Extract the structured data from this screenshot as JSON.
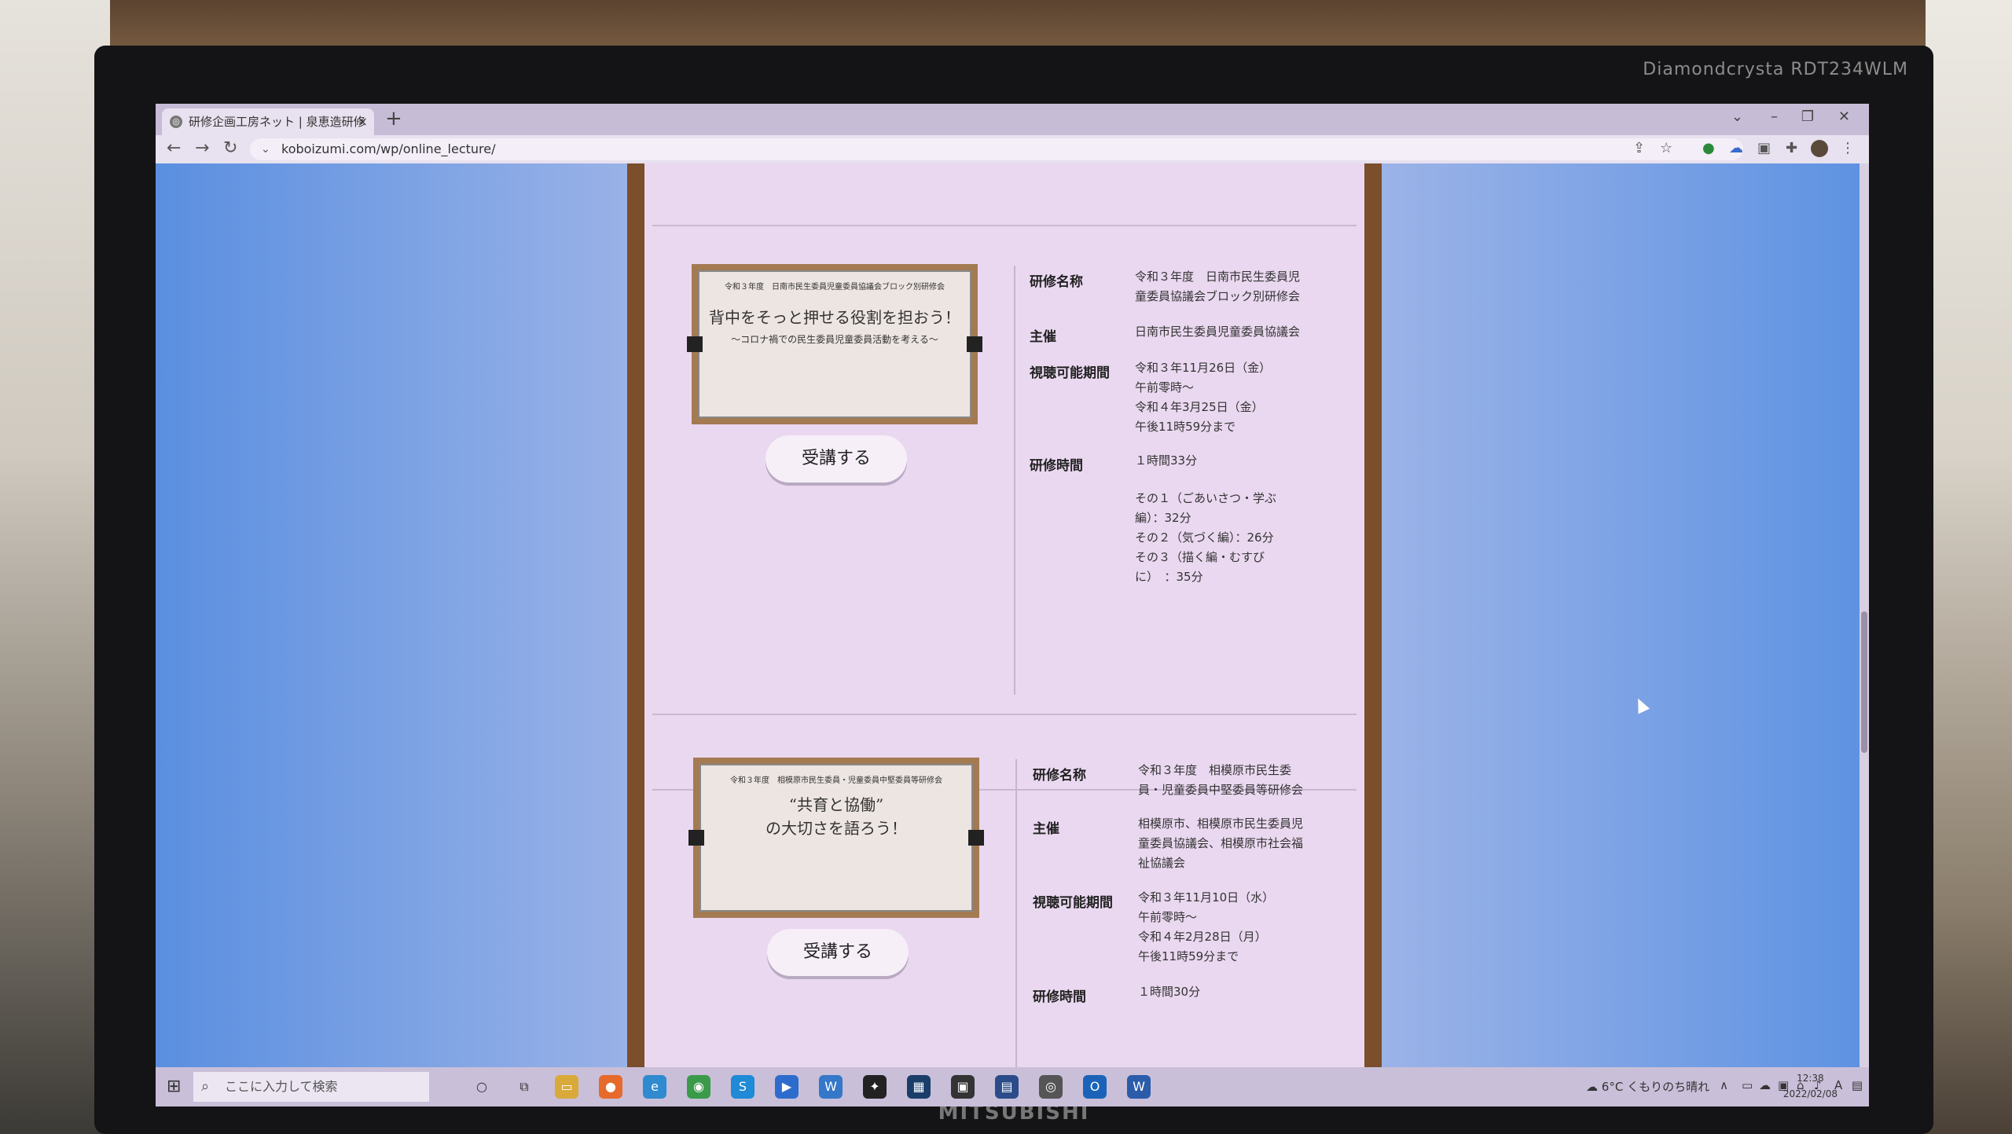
{
  "monitor": {
    "brand_top": "Diamondcrysta RDT234WLM",
    "brand_bottom": "MITSUBISHI"
  },
  "browser": {
    "tab_title": "研修企画工房ネット | 泉恵造研修",
    "url": "koboizumi.com/wp/online_lecture/"
  },
  "courses": [
    {
      "thumb_top": "令和３年度　日南市民生委員児童委員協議会ブロック別研修会",
      "thumb_title": "背中をそっと押せる役割を担おう！",
      "thumb_sub": "〜コロナ禍での民生委員児童委員活動を考える〜",
      "button": "受講する",
      "name_label": "研修名称",
      "name_value": "令和３年度　日南市民生委員児\n童委員協議会ブロック別研修会",
      "host_label": "主催",
      "host_value": "日南市民生委員児童委員協議会",
      "period_label": "視聴可能期間",
      "period_value": "令和３年11月26日（金）\n午前零時～\n令和４年3月25日（金）\n午後11時59分まで",
      "time_label": "研修時間",
      "time_value": "１時間33分",
      "parts_value": "その１（ごあいさつ・学ぶ\n編）：32分\nその２（気づく編）：26分\nその３（描く編・むすび\nに）　：35分"
    },
    {
      "thumb_top": "令和３年度　相模原市民生委員・児童委員中堅委員等研修会",
      "thumb_title": "“共育と協働”\nの大切さを語ろう！",
      "thumb_sub": "",
      "button": "受講する",
      "name_label": "研修名称",
      "name_value": "令和３年度　相模原市民生委\n員・児童委員中堅委員等研修会",
      "host_label": "主催",
      "host_value": "相模原市、相模原市民生委員児\n童委員協議会、相模原市社会福\n祉協議会",
      "period_label": "視聴可能期間",
      "period_value": "令和３年11月10日（水）\n午前零時～\n令和４年2月28日（月）\n午後11時59分まで",
      "time_label": "研修時間",
      "time_value": "１時間30分"
    }
  ],
  "taskbar": {
    "search_placeholder": "ここに入力して検索",
    "weather": "6°C くもりのち晴れ",
    "time": "12:38",
    "date": "2022/02/08",
    "ime": "A"
  }
}
